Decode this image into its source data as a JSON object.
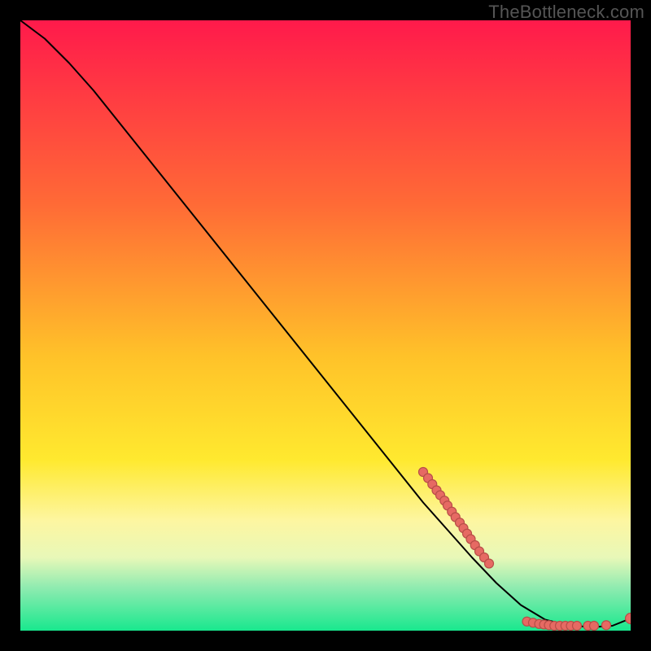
{
  "watermark": "TheBottleneck.com",
  "chart_data": {
    "type": "line",
    "title": "",
    "xlabel": "",
    "ylabel": "",
    "xlim": [
      0,
      100
    ],
    "ylim": [
      0,
      100
    ],
    "background_gradient": {
      "stops": [
        {
          "offset": 0,
          "color": "#ff1a4b"
        },
        {
          "offset": 30,
          "color": "#ff6a36"
        },
        {
          "offset": 55,
          "color": "#ffc229"
        },
        {
          "offset": 72,
          "color": "#ffe92f"
        },
        {
          "offset": 82,
          "color": "#fdf6a1"
        },
        {
          "offset": 88,
          "color": "#e8f8b8"
        },
        {
          "offset": 93,
          "color": "#8eebb0"
        },
        {
          "offset": 100,
          "color": "#19e88e"
        }
      ]
    },
    "curve": [
      {
        "x": 0,
        "y": 100
      },
      {
        "x": 4,
        "y": 97
      },
      {
        "x": 8,
        "y": 93
      },
      {
        "x": 12,
        "y": 88.5
      },
      {
        "x": 20,
        "y": 78.5
      },
      {
        "x": 30,
        "y": 66
      },
      {
        "x": 40,
        "y": 53.5
      },
      {
        "x": 50,
        "y": 41
      },
      {
        "x": 60,
        "y": 28.5
      },
      {
        "x": 66,
        "y": 21
      },
      {
        "x": 70,
        "y": 16.5
      },
      {
        "x": 74,
        "y": 12
      },
      {
        "x": 78,
        "y": 7.8
      },
      {
        "x": 82,
        "y": 4.2
      },
      {
        "x": 86,
        "y": 1.8
      },
      {
        "x": 90,
        "y": 0.8
      },
      {
        "x": 94,
        "y": 0.6
      },
      {
        "x": 97,
        "y": 0.8
      },
      {
        "x": 100,
        "y": 2.0
      }
    ],
    "points_cluster_upper": [
      {
        "x": 66.0,
        "y": 26.0
      },
      {
        "x": 66.8,
        "y": 25.0
      },
      {
        "x": 67.5,
        "y": 24.0
      },
      {
        "x": 68.2,
        "y": 23.0
      },
      {
        "x": 68.8,
        "y": 22.2
      },
      {
        "x": 69.5,
        "y": 21.3
      },
      {
        "x": 70.0,
        "y": 20.5
      },
      {
        "x": 70.7,
        "y": 19.5
      },
      {
        "x": 71.3,
        "y": 18.6
      },
      {
        "x": 72.0,
        "y": 17.7
      },
      {
        "x": 72.6,
        "y": 16.8
      },
      {
        "x": 73.2,
        "y": 15.9
      },
      {
        "x": 73.8,
        "y": 15.0
      },
      {
        "x": 74.5,
        "y": 14.0
      },
      {
        "x": 75.2,
        "y": 13.0
      },
      {
        "x": 76.0,
        "y": 12.0
      },
      {
        "x": 76.8,
        "y": 11.0
      }
    ],
    "points_cluster_lower": [
      {
        "x": 83.0,
        "y": 1.5
      },
      {
        "x": 84.0,
        "y": 1.3
      },
      {
        "x": 85.0,
        "y": 1.1
      },
      {
        "x": 85.8,
        "y": 1.0
      },
      {
        "x": 86.6,
        "y": 0.9
      },
      {
        "x": 87.5,
        "y": 0.8
      },
      {
        "x": 88.4,
        "y": 0.8
      },
      {
        "x": 89.3,
        "y": 0.8
      },
      {
        "x": 90.2,
        "y": 0.8
      },
      {
        "x": 91.2,
        "y": 0.8
      },
      {
        "x": 93.0,
        "y": 0.8
      },
      {
        "x": 94.0,
        "y": 0.8
      },
      {
        "x": 96.0,
        "y": 0.9
      },
      {
        "x": 100.0,
        "y": 2.0
      }
    ],
    "point_style": {
      "radius_small": 5.5,
      "radius_end": 6.5,
      "fill": "#e66a63",
      "stroke": "#b84e48",
      "stroke_width": 1.2
    },
    "line_style": {
      "stroke": "#000000",
      "width": 2
    }
  }
}
